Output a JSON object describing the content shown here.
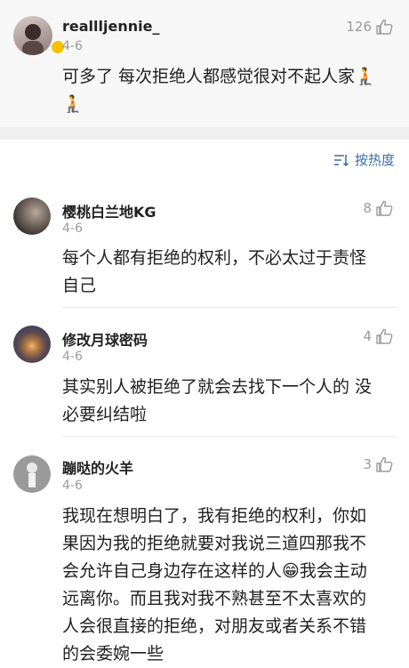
{
  "featured": {
    "username": "reallljennie_",
    "date": "4-6",
    "likes": "126",
    "text_line1": "可多了 每次拒绝人都感觉很对不起人家",
    "emoji": "🧎"
  },
  "sort": {
    "label": "按热度"
  },
  "comments": [
    {
      "username": "樱桃白兰地KG",
      "date": "4-6",
      "likes": "8",
      "lines": [
        "每个人都有拒绝的权利，不必太过于责怪",
        "自己"
      ]
    },
    {
      "username": "修改月球密码",
      "date": "4-6",
      "likes": "4",
      "lines": [
        "其实别人被拒绝了就会去找下一个人的 没",
        "必要纠结啦"
      ]
    },
    {
      "username": "蹦哒的火羊",
      "date": "4-6",
      "likes": "3",
      "lines": [
        "我现在想明白了，我有拒绝的权利，你如",
        "果因为我的拒绝就要对我说三道四那我不",
        "会允许自己身边存在这样的人😁我会主动",
        "远离你。而且我对我不熟甚至不太喜欢的",
        "人会很直接的拒绝，对朋友或者关系不错",
        "的会委婉一些"
      ]
    }
  ]
}
